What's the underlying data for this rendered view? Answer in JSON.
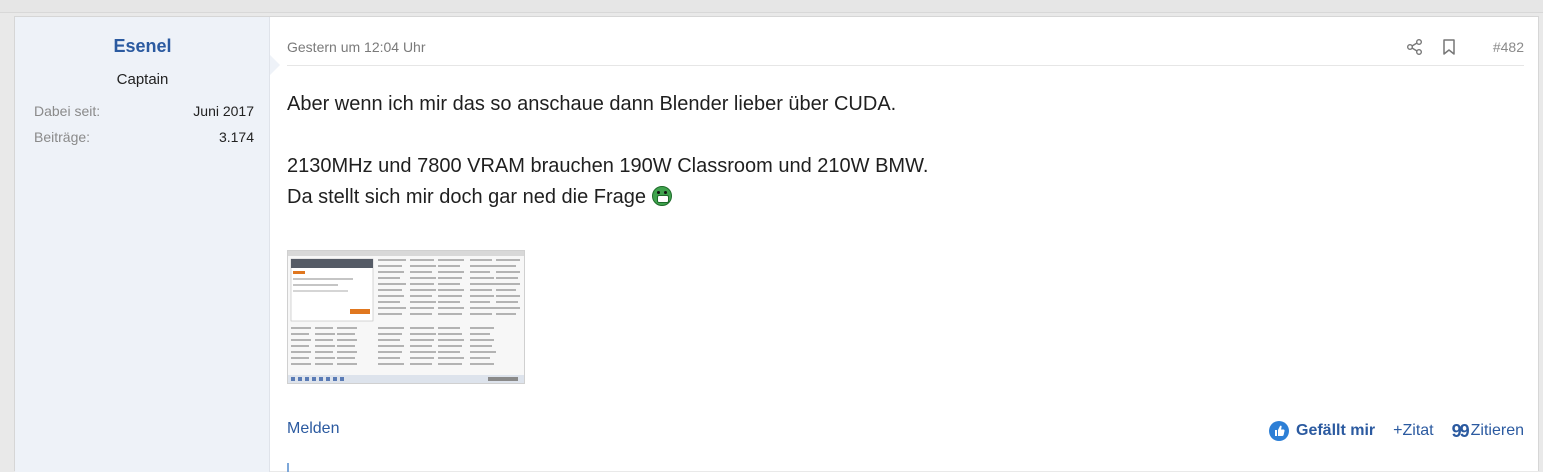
{
  "user": {
    "name": "Esenel",
    "title": "Captain",
    "stats": [
      {
        "label": "Dabei seit:",
        "value": "Juni 2017"
      },
      {
        "label": "Beiträge:",
        "value": "3.174"
      }
    ]
  },
  "post": {
    "date": "Gestern um 12:04 Uhr",
    "number": "#482",
    "lines": [
      "Aber wenn ich mir das so anschaue dann Blender lieber über CUDA.",
      "2130MHz und 7800 VRAM brauchen 190W Classroom und 210W BMW.",
      "Da stellt sich mir doch gar ned die Frage"
    ],
    "icons": {
      "share": "share-icon",
      "bookmark": "bookmark-icon",
      "emoji": "grin-emoji-icon",
      "like": "thumbs-up-icon",
      "quote": "quote-icon"
    }
  },
  "footer": {
    "report_label": "Melden",
    "like_label": "Gefällt mir",
    "quote_add_label": "+Zitat",
    "reply_label": "Zitieren"
  },
  "colors": {
    "accent": "#2b5aa0",
    "like_blue": "#2d7fd6",
    "user_cell_bg": "#eef2f8"
  }
}
